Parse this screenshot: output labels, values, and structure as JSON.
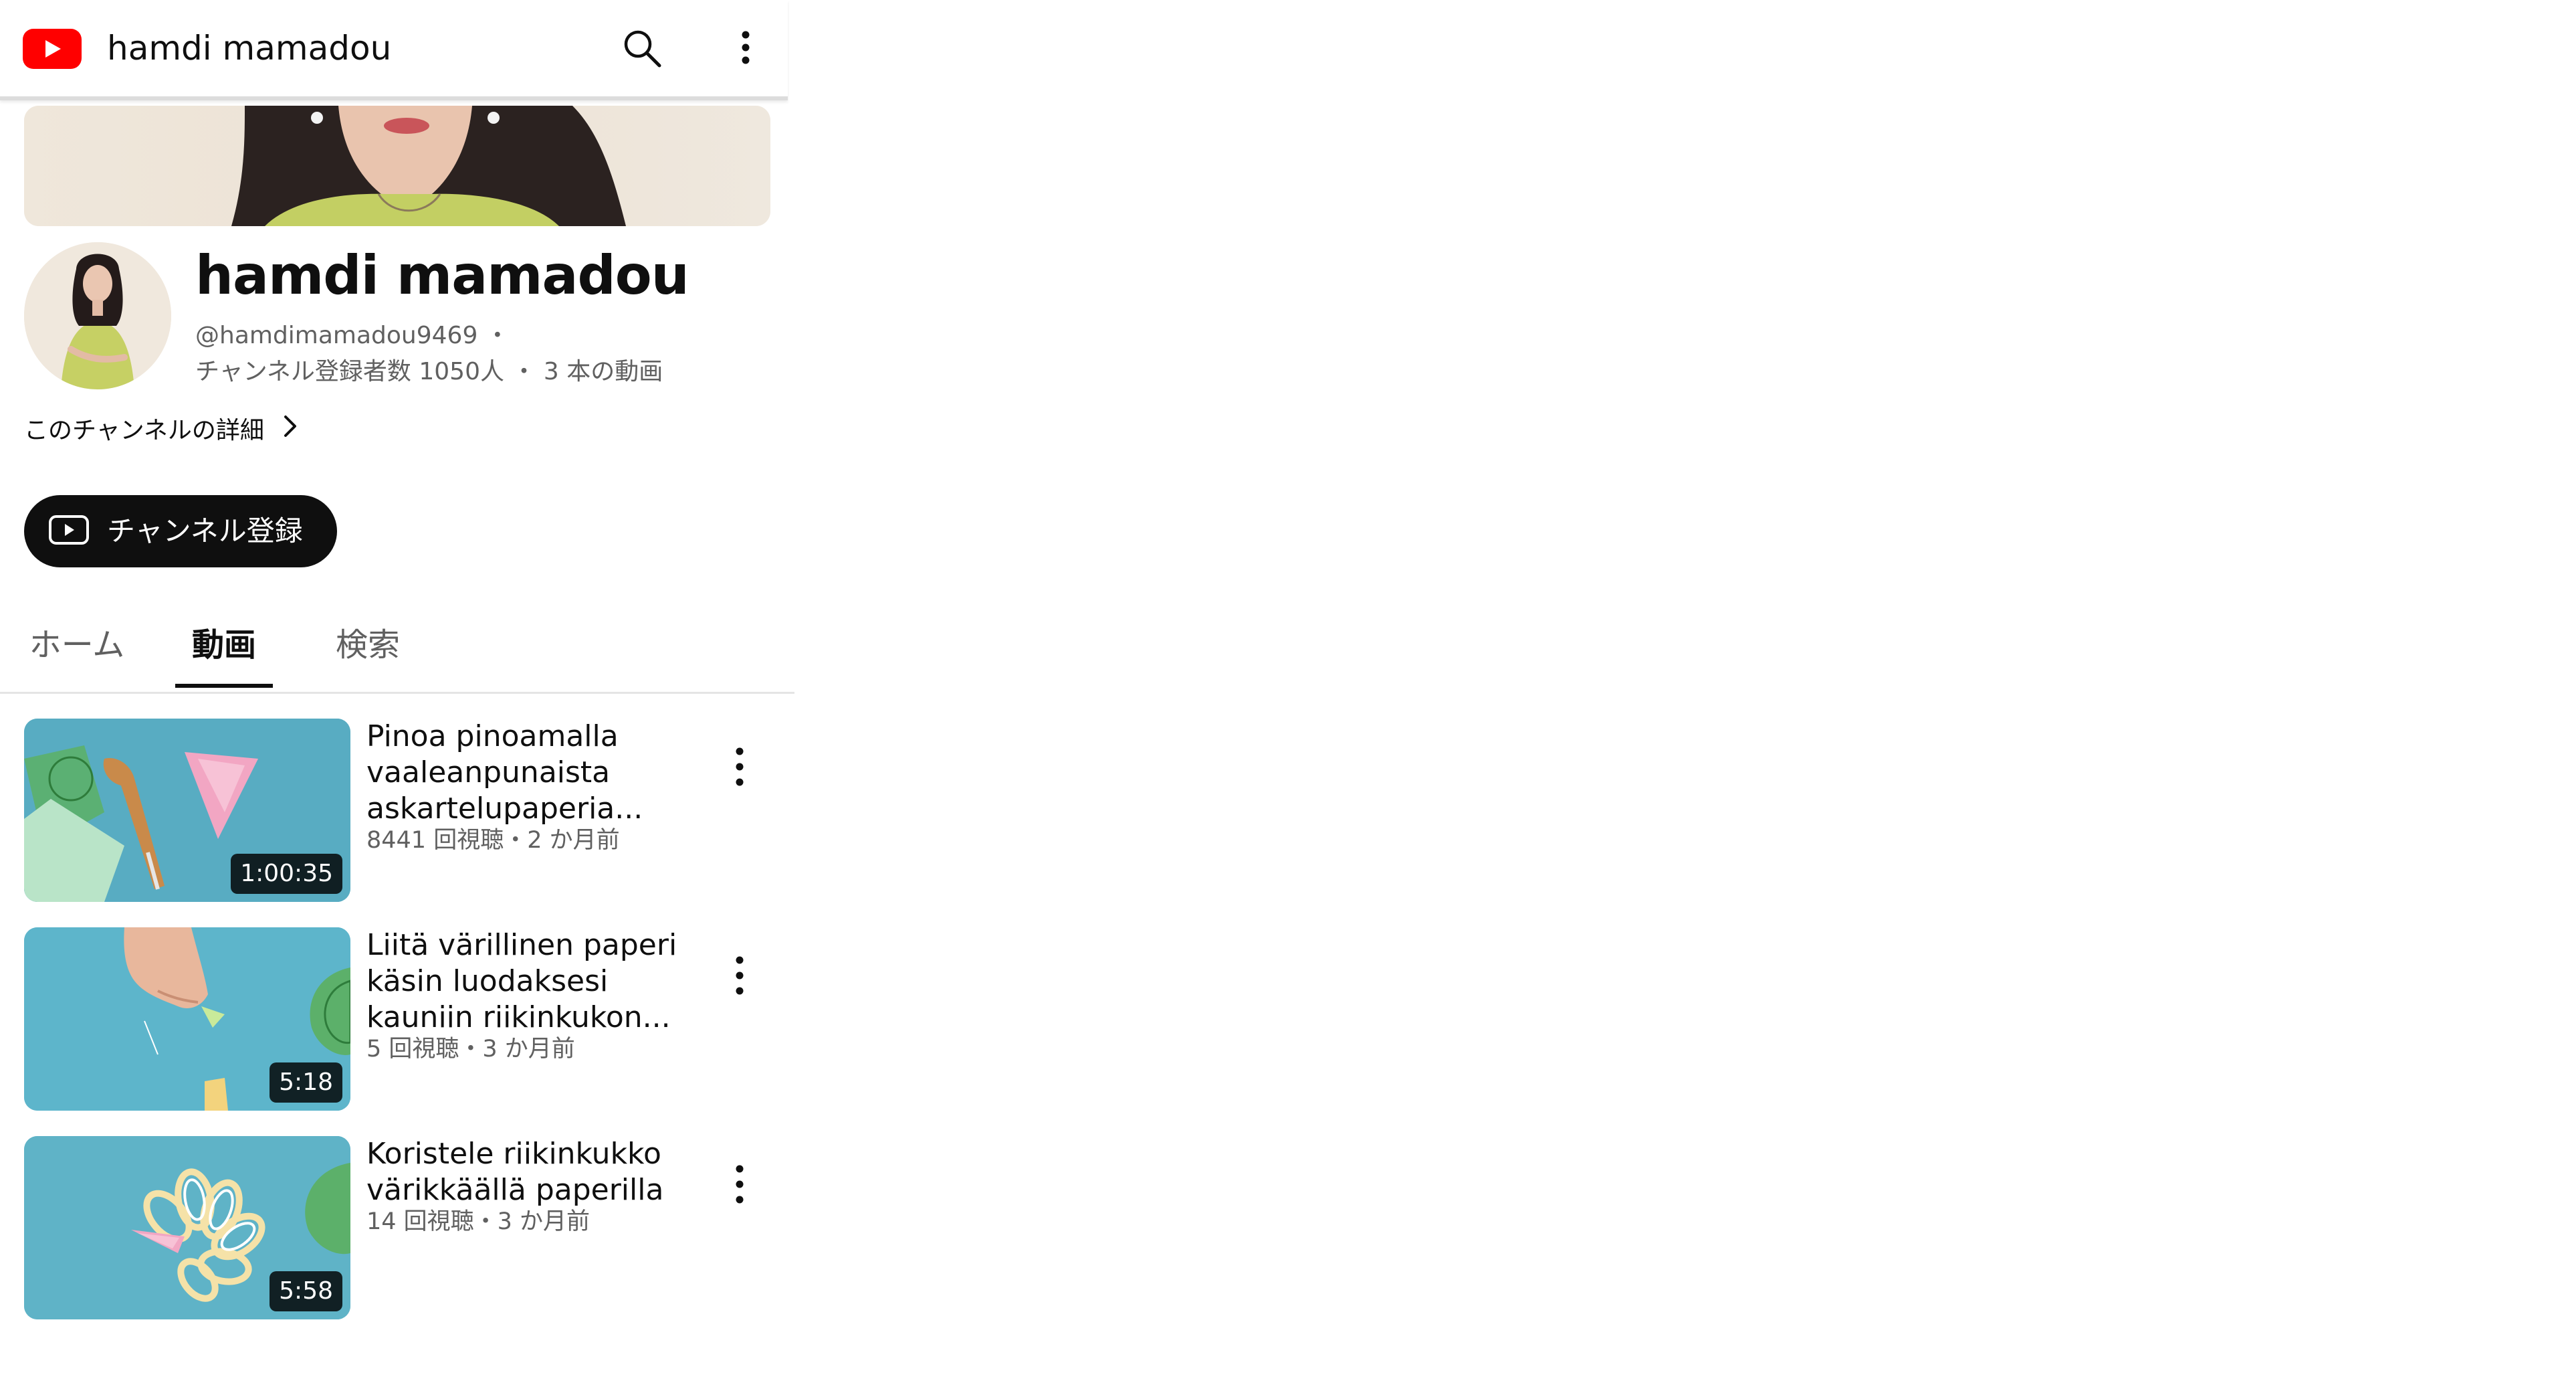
{
  "app": {
    "title": "hamdi mamadou",
    "brand_color": "#ff0000"
  },
  "topbar": {
    "logo_icon": "youtube-logo-icon",
    "title": "hamdi mamadou",
    "search_icon": "search-icon",
    "more_icon": "more-vert-icon"
  },
  "channel": {
    "name": "hamdi mamadou",
    "handle": "@hamdimamadou9469",
    "handle_separator": "・",
    "subscribers": "チャンネル登録者数 1050人",
    "stats_separator": "・",
    "video_count": "3 本の動画",
    "about_link": "このチャンネルの詳細"
  },
  "subscribe": {
    "label": "チャンネル登録",
    "icon": "youtube-play-icon"
  },
  "tabs": [
    {
      "label": "ホーム",
      "active": false
    },
    {
      "label": "動画",
      "active": true
    },
    {
      "label": "検索",
      "active": false
    }
  ],
  "videos": [
    {
      "title": "Pinoa pinoamalla vaaleanpunaista askartelupaperia...",
      "meta": "8441 回視聴・2 か月前",
      "duration": "1:00:35"
    },
    {
      "title": "Liitä värillinen paperi käsin luodaksesi kauniin riikinkukon...",
      "meta": "5 回視聴・3 か月前",
      "duration": "5:18"
    },
    {
      "title": "Koristele riikinkukko värikkäällä paperilla",
      "meta": "14 回視聴・3 か月前",
      "duration": "5:58"
    }
  ]
}
